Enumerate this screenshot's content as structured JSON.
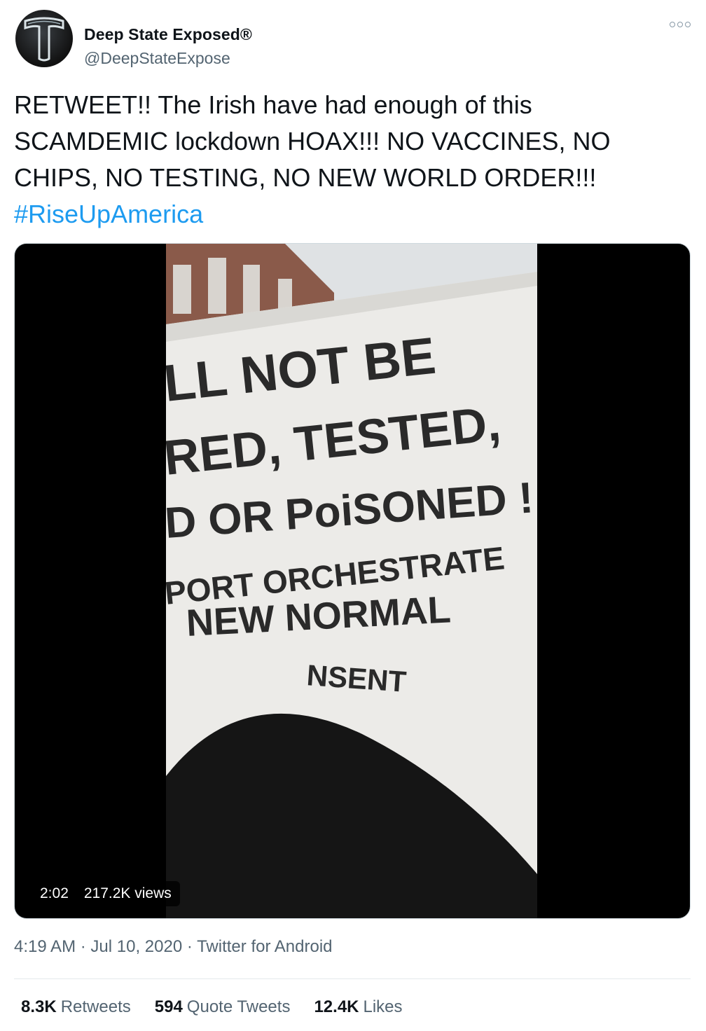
{
  "author": {
    "name": "Deep State Exposed®",
    "handle": "@DeepStateExpose",
    "avatar_icon": "letter-t-logo-icon"
  },
  "tweet": {
    "text": "RETWEET!! The Irish have had enough of this SCAMDEMIC lockdown HOAX!!! NO VACCINES, NO CHIPS, NO TESTING, NO NEW WORLD ORDER!!!",
    "hashtag": "#RiseUpAmerica"
  },
  "video": {
    "duration": "2:02",
    "views": "217.2K views",
    "banner_lines": [
      "LL NOT BE",
      "RED, TESTED,",
      "D OR PoiSONED !",
      "PORT ORCHESTRATE",
      "NEW NORMAL",
      "NSENT"
    ]
  },
  "meta": {
    "time": "4:19 AM",
    "date": "Jul 10, 2020",
    "source": "Twitter for Android",
    "separator": "·"
  },
  "stats": {
    "retweets_count": "8.3K",
    "retweets_label": "Retweets",
    "quotes_count": "594",
    "quotes_label": "Quote Tweets",
    "likes_count": "12.4K",
    "likes_label": "Likes"
  },
  "colors": {
    "link": "#1d9bf0",
    "secondary": "#536471"
  }
}
